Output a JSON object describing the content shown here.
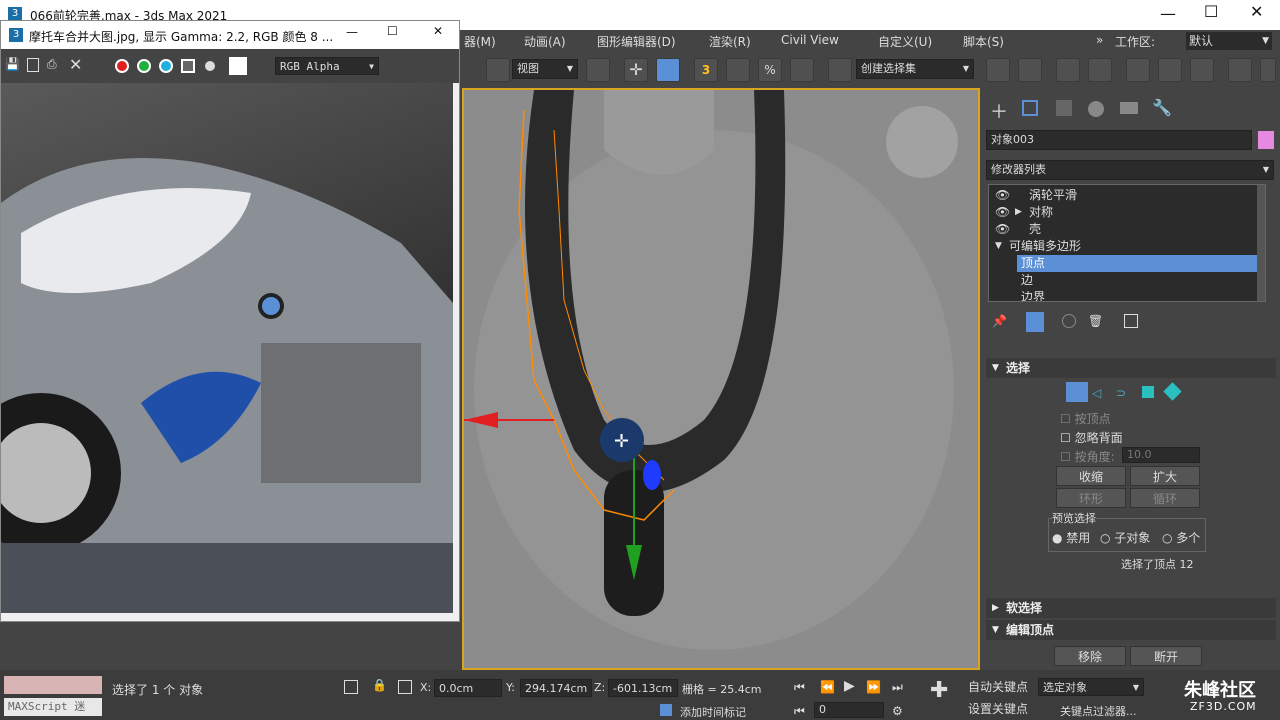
{
  "app": {
    "title": "066前轮完善.max - 3ds Max 2021",
    "icon": "3"
  },
  "image_window": {
    "title": "摩托车合并大图.jpg, 显示 Gamma: 2.2, RGB 颜色 8 ...",
    "channel_select": "RGB Alpha"
  },
  "menus": [
    "器(M)",
    "动画(A)",
    "图形编辑器(D)",
    "渲染(R)",
    "Civil View",
    "自定义(U)",
    "脚本(S)"
  ],
  "workspace": {
    "label": "工作区:",
    "value": "默认"
  },
  "toolbar": {
    "view_select": "视图",
    "selection_set": "创建选择集"
  },
  "command_panel": {
    "object_name": "对象003",
    "modifier_list": "修改器列表",
    "stack": [
      "涡轮平滑",
      "对称",
      "壳",
      "可编辑多边形",
      "顶点",
      "边",
      "边界"
    ],
    "selection": {
      "header": "选择",
      "by_vertex": "按顶点",
      "ignore_backfacing": "忽略背面",
      "by_angle": "按角度:",
      "angle_value": "10.0",
      "shrink": "收缩",
      "grow": "扩大",
      "ring": "环形",
      "loop": "循环",
      "preview_label": "预览选择",
      "preview_options": [
        "禁用",
        "子对象",
        "多个"
      ],
      "status": "选择了顶点 12"
    },
    "soft_selection": "软选择",
    "edit_vertices": {
      "header": "编辑顶点",
      "remove": "移除",
      "break": "断开"
    }
  },
  "status": {
    "maxscript": "MAXScript 迷",
    "selected": "选择了 1 个 对象",
    "x_label": "X:",
    "x": "0.0cm",
    "y_label": "Y:",
    "y": "294.174cm",
    "z_label": "Z:",
    "z": "-601.13cm",
    "grid": "栅格 = 25.4cm",
    "add_time_tag": "添加时间标记",
    "auto_key": "自动关键点",
    "set_key": "设置关键点",
    "selected_object": "选定对象",
    "key_filters": "关键点过滤器...",
    "frame": "0"
  },
  "watermark": {
    "brand": "朱峰社区",
    "url": "ZF3D.COM"
  },
  "colors": {
    "accent": "#5b8fd6",
    "viewport_border": "#d9a520",
    "vertex": "#ff8c00"
  }
}
